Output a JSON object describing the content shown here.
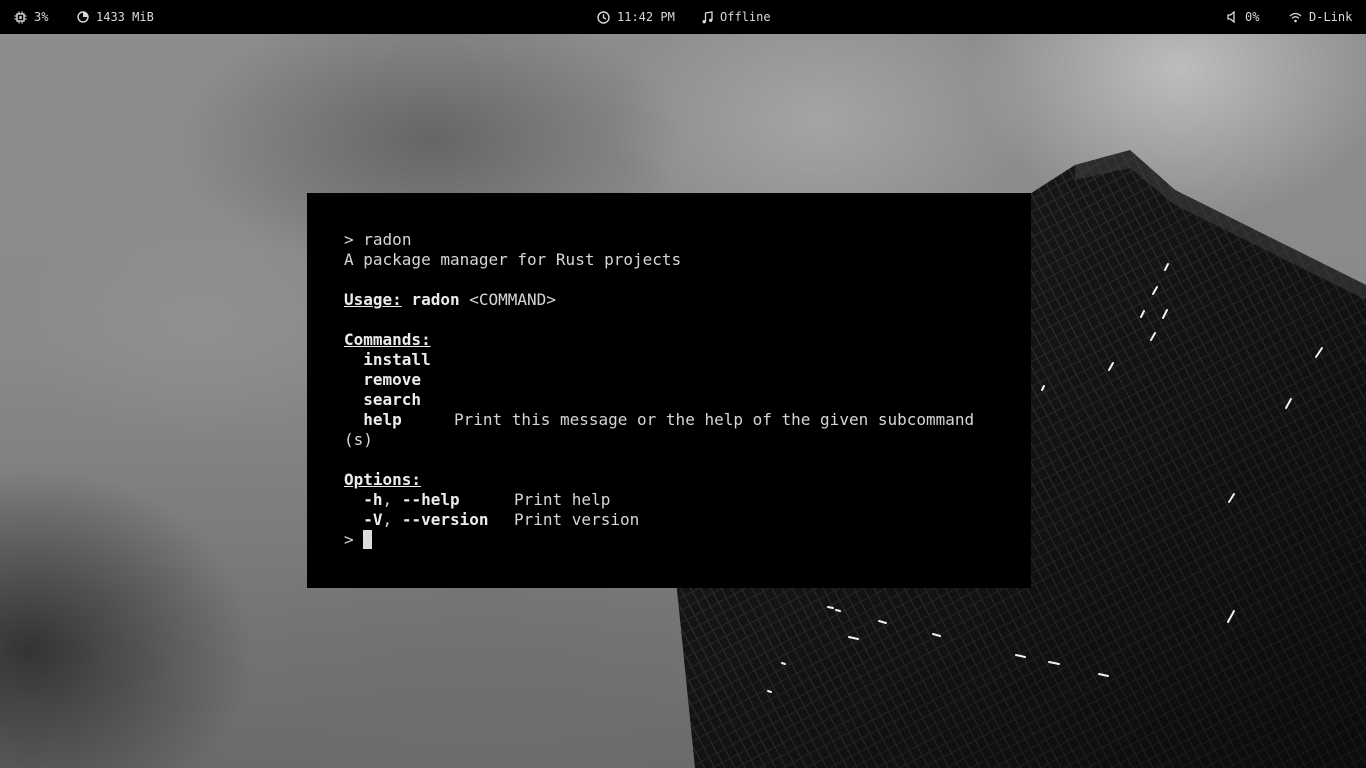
{
  "topbar": {
    "cpu": {
      "icon": "cpu-icon",
      "value": "3%"
    },
    "memory": {
      "icon": "memory-pie-icon",
      "value": "1433 MiB"
    },
    "clock": {
      "icon": "clock-icon",
      "value": "11:42 PM"
    },
    "music": {
      "icon": "music-note-icon",
      "value": "Offline"
    },
    "volume": {
      "icon": "speaker-icon",
      "value": "0%"
    },
    "network": {
      "icon": "wifi-icon",
      "value": "D-Link"
    }
  },
  "terminal": {
    "prompt": ">",
    "command": "radon",
    "description": "A package manager for Rust projects",
    "usage_label": "Usage:",
    "usage_bin": "radon",
    "usage_args": "<COMMAND>",
    "commands_label": "Commands:",
    "commands": [
      {
        "name": "install",
        "desc": ""
      },
      {
        "name": "remove",
        "desc": ""
      },
      {
        "name": "search",
        "desc": ""
      },
      {
        "name": "help",
        "desc": "Print this message or the help of the given subcommand"
      }
    ],
    "help_wrap": "(s)",
    "options_label": "Options:",
    "options": [
      {
        "short": "-h",
        "sep": ",",
        "long": "--help",
        "desc": "Print help"
      },
      {
        "short": "-V",
        "sep": ",",
        "long": "--version",
        "desc": "Print version"
      }
    ]
  },
  "colors": {
    "bar_bg": "#000000",
    "terminal_bg": "#000000",
    "terminal_fg": "#d6d6d6"
  }
}
